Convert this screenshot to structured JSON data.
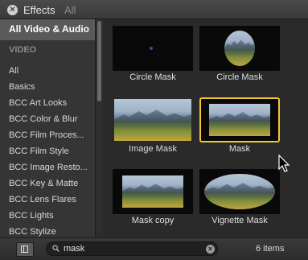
{
  "window": {
    "title": "Effects",
    "subtitle": "All"
  },
  "sidebar": {
    "items": [
      {
        "label": "All Video & Audio"
      },
      {
        "label": "VIDEO"
      },
      {
        "label": "All"
      },
      {
        "label": "Basics"
      },
      {
        "label": "BCC Art Looks"
      },
      {
        "label": "BCC Color & Blur"
      },
      {
        "label": "BCC Film Proces..."
      },
      {
        "label": "BCC Film Style"
      },
      {
        "label": "BCC Image Resto..."
      },
      {
        "label": "BCC Key & Matte"
      },
      {
        "label": "BCC Lens Flares"
      },
      {
        "label": "BCC Lights"
      },
      {
        "label": "BCC Stylize"
      }
    ]
  },
  "effects": {
    "items": [
      {
        "label": "Circle Mask",
        "thumb": "black-dot"
      },
      {
        "label": "Circle Mask",
        "thumb": "circle-landscape"
      },
      {
        "label": "Image Mask",
        "thumb": "landscape"
      },
      {
        "label": "Mask",
        "thumb": "framed-landscape",
        "selected": true
      },
      {
        "label": "Mask copy",
        "thumb": "framed-landscape"
      },
      {
        "label": "Vignette Mask",
        "thumb": "vignette-landscape"
      }
    ]
  },
  "search": {
    "value": "mask",
    "placeholder": ""
  },
  "status": {
    "count": "6 items"
  },
  "colors": {
    "selection": "#f3c62e",
    "background": "#2a2a2a",
    "sidebar": "#353535"
  }
}
